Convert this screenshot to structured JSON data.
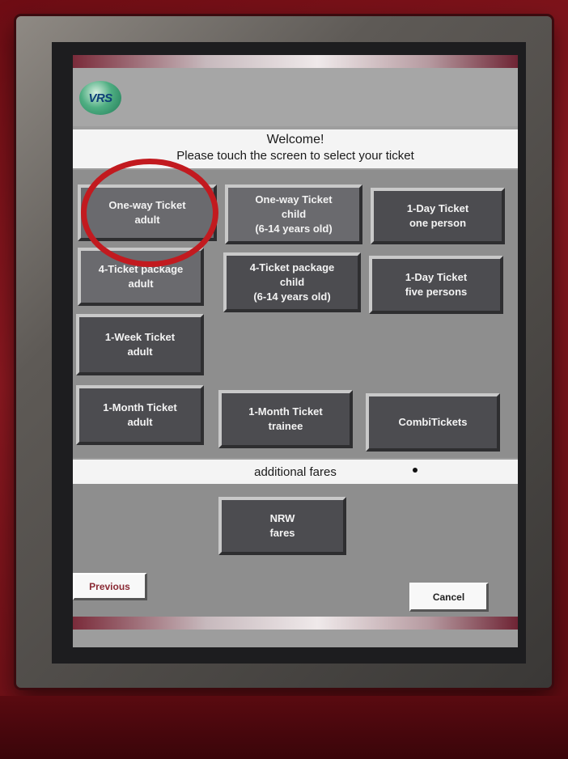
{
  "header": {
    "logo_text": "VRS",
    "welcome_line1": "Welcome!",
    "welcome_line2": "Please touch the screen to select your ticket"
  },
  "tickets": [
    {
      "line1": "One-way Ticket",
      "line2": "adult",
      "line3": ""
    },
    {
      "line1": "One-way Ticket",
      "line2": "child",
      "line3": "(6-14 years old)"
    },
    {
      "line1": "1-Day Ticket",
      "line2": "one person",
      "line3": ""
    },
    {
      "line1": "4-Ticket package",
      "line2": "adult",
      "line3": ""
    },
    {
      "line1": "4-Ticket package",
      "line2": "child",
      "line3": "(6-14 years old)"
    },
    {
      "line1": "1-Day Ticket",
      "line2": "five persons",
      "line3": ""
    },
    {
      "line1": "1-Week Ticket",
      "line2": "adult",
      "line3": ""
    },
    {
      "line1": "1-Month Ticket",
      "line2": "adult",
      "line3": ""
    },
    {
      "line1": "1-Month Ticket",
      "line2": "trainee",
      "line3": ""
    },
    {
      "line1": "CombiTickets",
      "line2": "",
      "line3": ""
    }
  ],
  "additional_fares_label": "additional fares",
  "nrw_button": {
    "line1": "NRW",
    "line2": "fares"
  },
  "nav": {
    "previous_label": "Previous",
    "cancel_label": "Cancel"
  },
  "colors": {
    "highlight_ring": "#c21a1f",
    "button_dark": "#4c4c50",
    "panel_gray": "#8e8e8e",
    "housing_red": "#7a1219"
  }
}
